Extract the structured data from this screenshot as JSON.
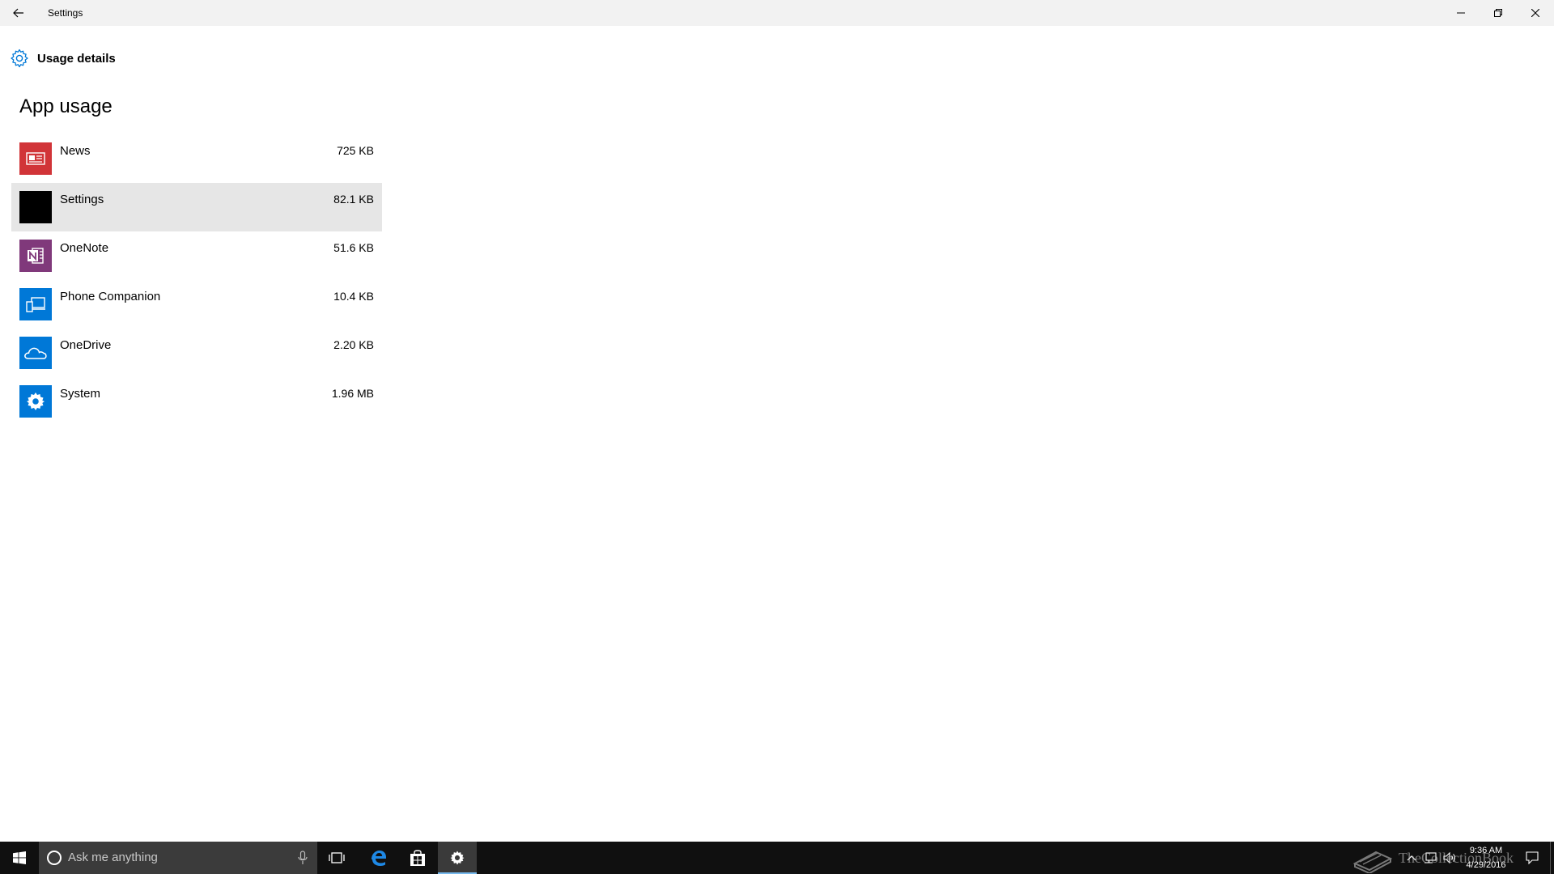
{
  "window": {
    "title": "Settings"
  },
  "page": {
    "title": "Usage details",
    "section_title": "App usage"
  },
  "apps": [
    {
      "name": "News",
      "size": "725 KB",
      "icon": "news-icon",
      "color": "#d13438"
    },
    {
      "name": "Settings",
      "size": "82.1 KB",
      "icon": "settings-app-icon",
      "color": "#000000",
      "selected": true
    },
    {
      "name": "OneNote",
      "size": "51.6 KB",
      "icon": "onenote-icon",
      "color": "#80397b"
    },
    {
      "name": "Phone Companion",
      "size": "10.4 KB",
      "icon": "phone-companion-icon",
      "color": "#0078d7"
    },
    {
      "name": "OneDrive",
      "size": "2.20 KB",
      "icon": "onedrive-icon",
      "color": "#0078d7"
    },
    {
      "name": "System",
      "size": "1.96 MB",
      "icon": "system-gear-icon",
      "color": "#0078d7"
    }
  ],
  "taskbar": {
    "search_placeholder": "Ask me anything",
    "time": "9:36 AM",
    "date": "4/29/2016"
  },
  "watermark": {
    "text": "TheCollectionBook"
  },
  "colors": {
    "accent": "#0078d7",
    "titlebar_bg": "#f2f2f2",
    "selected_row": "#e6e6e6",
    "taskbar_bg": "#101010"
  }
}
